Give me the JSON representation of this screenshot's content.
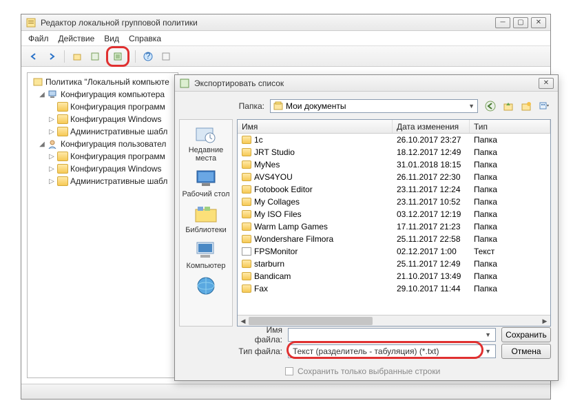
{
  "main": {
    "title": "Редактор локальной групповой политики",
    "menu": [
      "Файл",
      "Действие",
      "Вид",
      "Справка"
    ]
  },
  "tree": {
    "root": "Политика \"Локальный компьюте",
    "computer": "Конфигурация компьютера",
    "c1": "Конфигурация программ",
    "c2": "Конфигурация Windows",
    "c3": "Административные шабл",
    "user": "Конфигурация пользовател",
    "u1": "Конфигурация программ",
    "u2": "Конфигурация Windows",
    "u3": "Административные шабл"
  },
  "dialog": {
    "title": "Экспортировать список",
    "folder_label": "Папка:",
    "folder_value": "Мои документы",
    "cols": {
      "name": "Имя",
      "mod": "Дата изменения",
      "type": "Тип"
    },
    "places": [
      "Недавние места",
      "Рабочий стол",
      "Библиотеки",
      "Компьютер"
    ],
    "filename_label": "Имя файла:",
    "filetype_label": "Тип файла:",
    "filetype_value": "Текст (разделитель - табуляция) (*.txt)",
    "save_btn": "Сохранить",
    "cancel_btn": "Отмена",
    "checkbox": "Сохранить только выбранные строки",
    "files": [
      {
        "n": "1c",
        "d": "26.10.2017 23:27",
        "t": "Папка"
      },
      {
        "n": "JRT Studio",
        "d": "18.12.2017 12:49",
        "t": "Папка"
      },
      {
        "n": "MyNes",
        "d": "31.01.2018 18:15",
        "t": "Папка"
      },
      {
        "n": "AVS4YOU",
        "d": "26.11.2017 22:30",
        "t": "Папка"
      },
      {
        "n": "Fotobook Editor",
        "d": "23.11.2017 12:24",
        "t": "Папка"
      },
      {
        "n": "My Collages",
        "d": "23.11.2017 10:52",
        "t": "Папка"
      },
      {
        "n": "My ISO Files",
        "d": "03.12.2017 12:19",
        "t": "Папка"
      },
      {
        "n": "Warm Lamp Games",
        "d": "17.11.2017 21:23",
        "t": "Папка"
      },
      {
        "n": "Wondershare Filmora",
        "d": "25.11.2017 22:58",
        "t": "Папка"
      },
      {
        "n": "FPSMonitor",
        "d": "02.12.2017 1:00",
        "t": "Текст"
      },
      {
        "n": "starburn",
        "d": "25.11.2017 12:49",
        "t": "Папка"
      },
      {
        "n": "Bandicam",
        "d": "21.10.2017 13:49",
        "t": "Папка"
      },
      {
        "n": "Fax",
        "d": "29.10.2017 11:44",
        "t": "Папка"
      }
    ]
  }
}
